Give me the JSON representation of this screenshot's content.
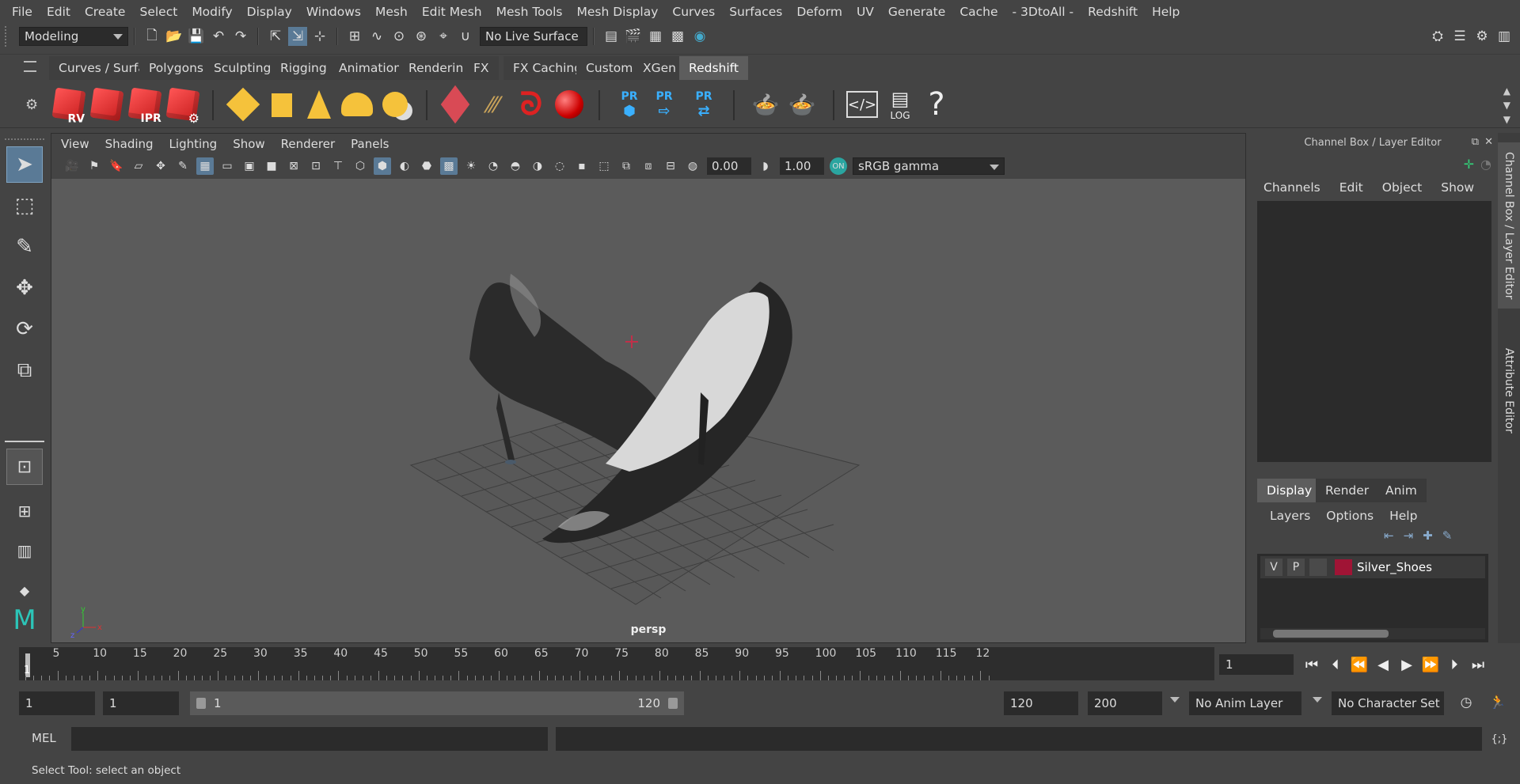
{
  "menu": [
    "File",
    "Edit",
    "Create",
    "Select",
    "Modify",
    "Display",
    "Windows",
    "Mesh",
    "Edit Mesh",
    "Mesh Tools",
    "Mesh Display",
    "Curves",
    "Surfaces",
    "Deform",
    "UV",
    "Generate",
    "Cache",
    "- 3DtoAll -",
    "Redshift",
    "Help"
  ],
  "status": {
    "mode": "Modeling",
    "live_surface": "No Live Surface"
  },
  "shelf_tabs": [
    "Curves / Surfaces",
    "Polygons",
    "Sculpting",
    "Rigging",
    "Animation",
    "Rendering",
    "FX",
    "FX Caching",
    "Custom",
    "XGen",
    "Redshift"
  ],
  "shelf_active": "Redshift",
  "shelf_icons": {
    "rv": "RV",
    "ipr": "IPR",
    "pr": "PR",
    "log": "LOG",
    "help": "?"
  },
  "panel_menu": [
    "View",
    "Shading",
    "Lighting",
    "Show",
    "Renderer",
    "Panels"
  ],
  "panel": {
    "exposure": "0.00",
    "gamma": "1.00",
    "colorspace": "sRGB gamma",
    "camera": "persp"
  },
  "channel_box": {
    "title": "Channel Box / Layer Editor",
    "menu": [
      "Channels",
      "Edit",
      "Object",
      "Show"
    ]
  },
  "layer_editor": {
    "tabs": [
      "Display",
      "Render",
      "Anim"
    ],
    "active_tab": "Display",
    "menu": [
      "Layers",
      "Options",
      "Help"
    ],
    "layer": {
      "v": "V",
      "p": "P",
      "name": "Silver_Shoes",
      "color": "#a01435"
    }
  },
  "side_tabs": [
    "Channel Box / Layer Editor",
    "Attribute Editor"
  ],
  "timeline": {
    "ticks": [
      "5",
      "10",
      "15",
      "20",
      "25",
      "30",
      "35",
      "40",
      "45",
      "50",
      "55",
      "60",
      "65",
      "70",
      "75",
      "80",
      "85",
      "90",
      "95",
      "100",
      "105",
      "110",
      "115",
      "12"
    ],
    "current_frame": "1",
    "frame_field": "1"
  },
  "range": {
    "start": "1",
    "anim_start": "1",
    "range_start": "1",
    "range_end": "120",
    "anim_end": "120",
    "end": "200",
    "anim_layer": "No Anim Layer",
    "char_set": "No Character Set"
  },
  "cmd": {
    "label": "MEL"
  },
  "help_line": "Select Tool: select an object"
}
